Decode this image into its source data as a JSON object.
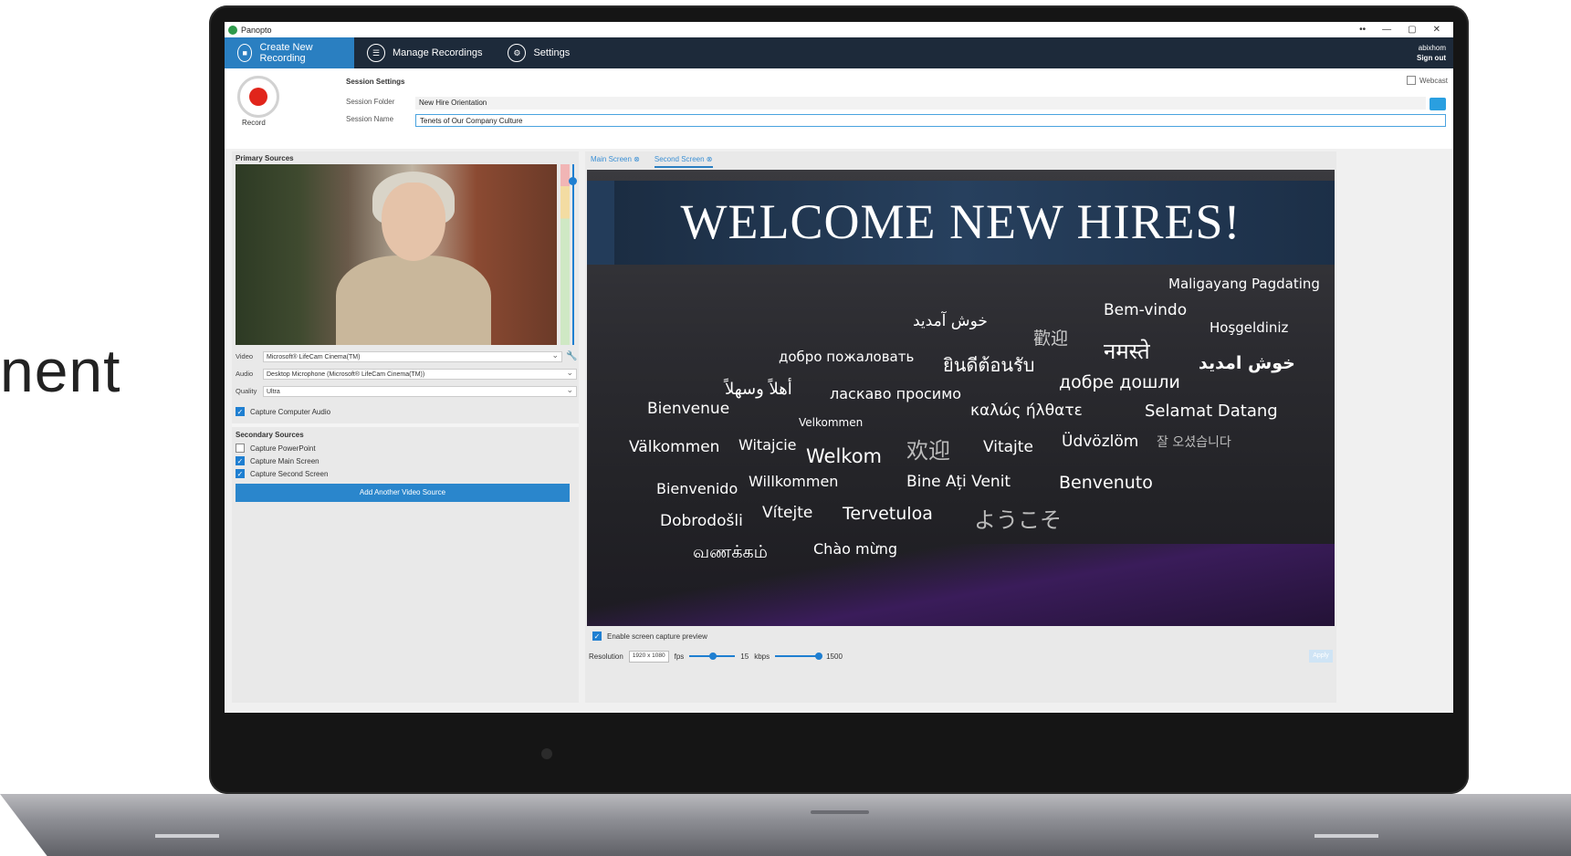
{
  "background": {
    "partial_text": "nent"
  },
  "app": {
    "title": "Panopto",
    "window_controls": [
      "••",
      "—",
      "▢",
      "✕"
    ]
  },
  "nav": {
    "tabs": [
      {
        "label": "Create New Recording",
        "icon": "video-camera-icon",
        "active": true
      },
      {
        "label": "Manage Recordings",
        "icon": "list-icon",
        "active": false
      },
      {
        "label": "Settings",
        "icon": "gear-icon",
        "active": false
      }
    ],
    "user": "abixhom",
    "sign_out": "Sign out"
  },
  "session": {
    "record_label": "Record",
    "title": "Session Settings",
    "folder_label": "Session Folder",
    "folder_value": "New Hire Orientation",
    "name_label": "Session Name",
    "name_value": "Tenets of Our Company Culture",
    "webcast_label": "Webcast"
  },
  "primary": {
    "title": "Primary Sources",
    "video_label": "Video",
    "video_value": "Microsoft® LifeCam Cinema(TM)",
    "audio_label": "Audio",
    "audio_value": "Desktop Microphone (Microsoft® LifeCam Cinema(TM))",
    "quality_label": "Quality",
    "quality_value": "Ultra",
    "capture_audio": "Capture Computer Audio"
  },
  "secondary": {
    "title": "Secondary Sources",
    "items": [
      {
        "label": "Capture PowerPoint",
        "checked": false
      },
      {
        "label": "Capture Main Screen",
        "checked": true
      },
      {
        "label": "Capture Second Screen",
        "checked": true
      }
    ],
    "add_button": "Add Another Video Source"
  },
  "screens": {
    "tabs": [
      "Main Screen",
      "Second Screen"
    ],
    "active_tab": "Second Screen"
  },
  "slide": {
    "title": "WELCOME NEW HIRES!",
    "words": [
      "Maligayang Pagdating",
      "Bem-vindo",
      "خوش آمدید",
      "歡迎",
      "Hoşgeldiniz",
      "добро пожаловать",
      "ยินดีต้อนรับ",
      "नमस्ते",
      "خوش امدید",
      "добре дошли",
      "أهلاً وسهلاً",
      "ласкаво просимо",
      "Bienvenue",
      "καλώς ήλθατε",
      "Selamat Datang",
      "Velkommen",
      "Välkommen",
      "Witajcie",
      "Welkom",
      "欢迎",
      "Vitajte",
      "Üdvözlöm",
      "잘 오셨습니다",
      "Bienvenido",
      "Willkommen",
      "Bine Ați Venit",
      "Benvenuto",
      "Dobrodošli",
      "Vítejte",
      "Tervetuloa",
      "ようこそ",
      "வணக்கம்",
      "Chào mừng"
    ]
  },
  "preview": {
    "label": "Enable screen capture preview",
    "checked": true
  },
  "capture": {
    "resolution_label": "Resolution",
    "resolution_value": "1920 x 1080",
    "fps_label": "fps",
    "fps_value": "15",
    "kbps_label": "kbps",
    "kbps_value": "1500",
    "apply": "Apply"
  }
}
